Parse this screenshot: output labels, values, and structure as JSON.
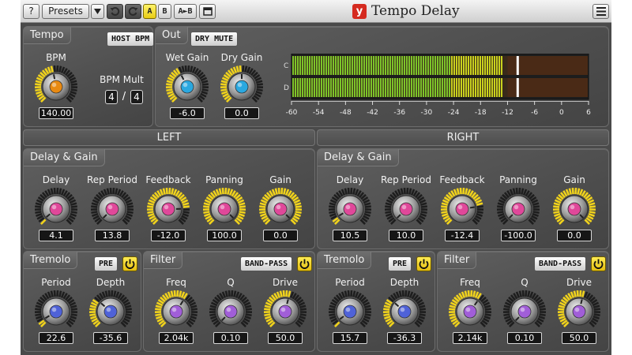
{
  "colors": {
    "accent_yellow": "#f0d21c",
    "knob_orange": "#e98a12",
    "knob_cyan": "#2aa8e0",
    "knob_pink": "#e0489a",
    "knob_blue": "#4f62d8",
    "knob_purple": "#a15ed8",
    "meter_green": "#7cc42a",
    "logo_red": "#d52a1f"
  },
  "titlebar": {
    "help_label": "?",
    "presets_label": "Presets",
    "presets_dropdown_icon": "triangle-down-icon",
    "undo_icon": "undo-icon",
    "redo_icon": "redo-icon",
    "a_label": "A",
    "b_label": "B",
    "a_to_b_label": "A►B",
    "compare_icon": "window-icon",
    "logo_letter": "y",
    "title": "Tempo Delay",
    "menu_icon": "hamburger-icon"
  },
  "tempo": {
    "tab": "Tempo",
    "host_bpm_label": "HOST BPM",
    "bpm": {
      "label": "BPM",
      "value": "140.00",
      "fraction": 0.46
    },
    "bpm_mult_label": "BPM Mult",
    "bpm_mult_num": "4",
    "bpm_mult_sep": "/",
    "bpm_mult_den": "4"
  },
  "out": {
    "tab": "Out",
    "dry_mute_label": "DRY MUTE",
    "wet_gain": {
      "label": "Wet Gain",
      "value": "-6.0",
      "fraction": 0.4
    },
    "dry_gain": {
      "label": "Dry Gain",
      "value": "0.0",
      "fraction": 0.5
    },
    "meter": {
      "channel_labels": [
        "C",
        "D"
      ],
      "scale_labels": [
        "-60",
        "-54",
        "-48",
        "-42",
        "-36",
        "-30",
        "-24",
        "-18",
        "-12",
        "-6",
        "0",
        "6"
      ],
      "level_db": -13,
      "peak_db": -10
    }
  },
  "left": {
    "header": "LEFT",
    "delay_gain": {
      "tab": "Delay & Gain",
      "knobs": [
        {
          "label": "Delay",
          "value": "4.1",
          "fraction": 0.02
        },
        {
          "label": "Rep Period",
          "value": "13.8",
          "fraction": 0.0
        },
        {
          "label": "Feedback",
          "value": "-12.0",
          "fraction": 0.83
        },
        {
          "label": "Panning",
          "value": "100.0",
          "fraction": 1.0
        },
        {
          "label": "Gain",
          "value": "0.0",
          "fraction": 1.0
        }
      ]
    },
    "tremolo": {
      "tab": "Tremolo",
      "pre_label": "PRE",
      "power_icon": "power-icon",
      "knobs": [
        {
          "label": "Period",
          "value": "22.6",
          "fraction": 0.05
        },
        {
          "label": "Depth",
          "value": "-35.6",
          "fraction": 0.32
        }
      ]
    },
    "filter": {
      "tab": "Filter",
      "mode_label": "BAND-PASS",
      "power_icon": "power-icon",
      "knobs": [
        {
          "label": "Freq",
          "value": "2.04k",
          "fraction": 0.62
        },
        {
          "label": "Q",
          "value": "0.10",
          "fraction": 0.0
        },
        {
          "label": "Drive",
          "value": "50.0",
          "fraction": 0.55
        }
      ]
    }
  },
  "right": {
    "header": "RIGHT",
    "delay_gain": {
      "tab": "Delay & Gain",
      "knobs": [
        {
          "label": "Delay",
          "value": "10.5",
          "fraction": 0.05
        },
        {
          "label": "Rep Period",
          "value": "10.0",
          "fraction": 0.0
        },
        {
          "label": "Feedback",
          "value": "-12.4",
          "fraction": 0.8
        },
        {
          "label": "Panning",
          "value": "-100.0",
          "fraction": 0.0
        },
        {
          "label": "Gain",
          "value": "0.0",
          "fraction": 1.0
        }
      ]
    },
    "tremolo": {
      "tab": "Tremolo",
      "pre_label": "PRE",
      "power_icon": "power-icon",
      "knobs": [
        {
          "label": "Period",
          "value": "15.7",
          "fraction": 0.03
        },
        {
          "label": "Depth",
          "value": "-36.3",
          "fraction": 0.32
        }
      ]
    },
    "filter": {
      "tab": "Filter",
      "mode_label": "BAND-PASS",
      "power_icon": "power-icon",
      "knobs": [
        {
          "label": "Freq",
          "value": "2.14k",
          "fraction": 0.63
        },
        {
          "label": "Q",
          "value": "0.10",
          "fraction": 0.0
        },
        {
          "label": "Drive",
          "value": "50.0",
          "fraction": 0.55
        }
      ]
    }
  }
}
